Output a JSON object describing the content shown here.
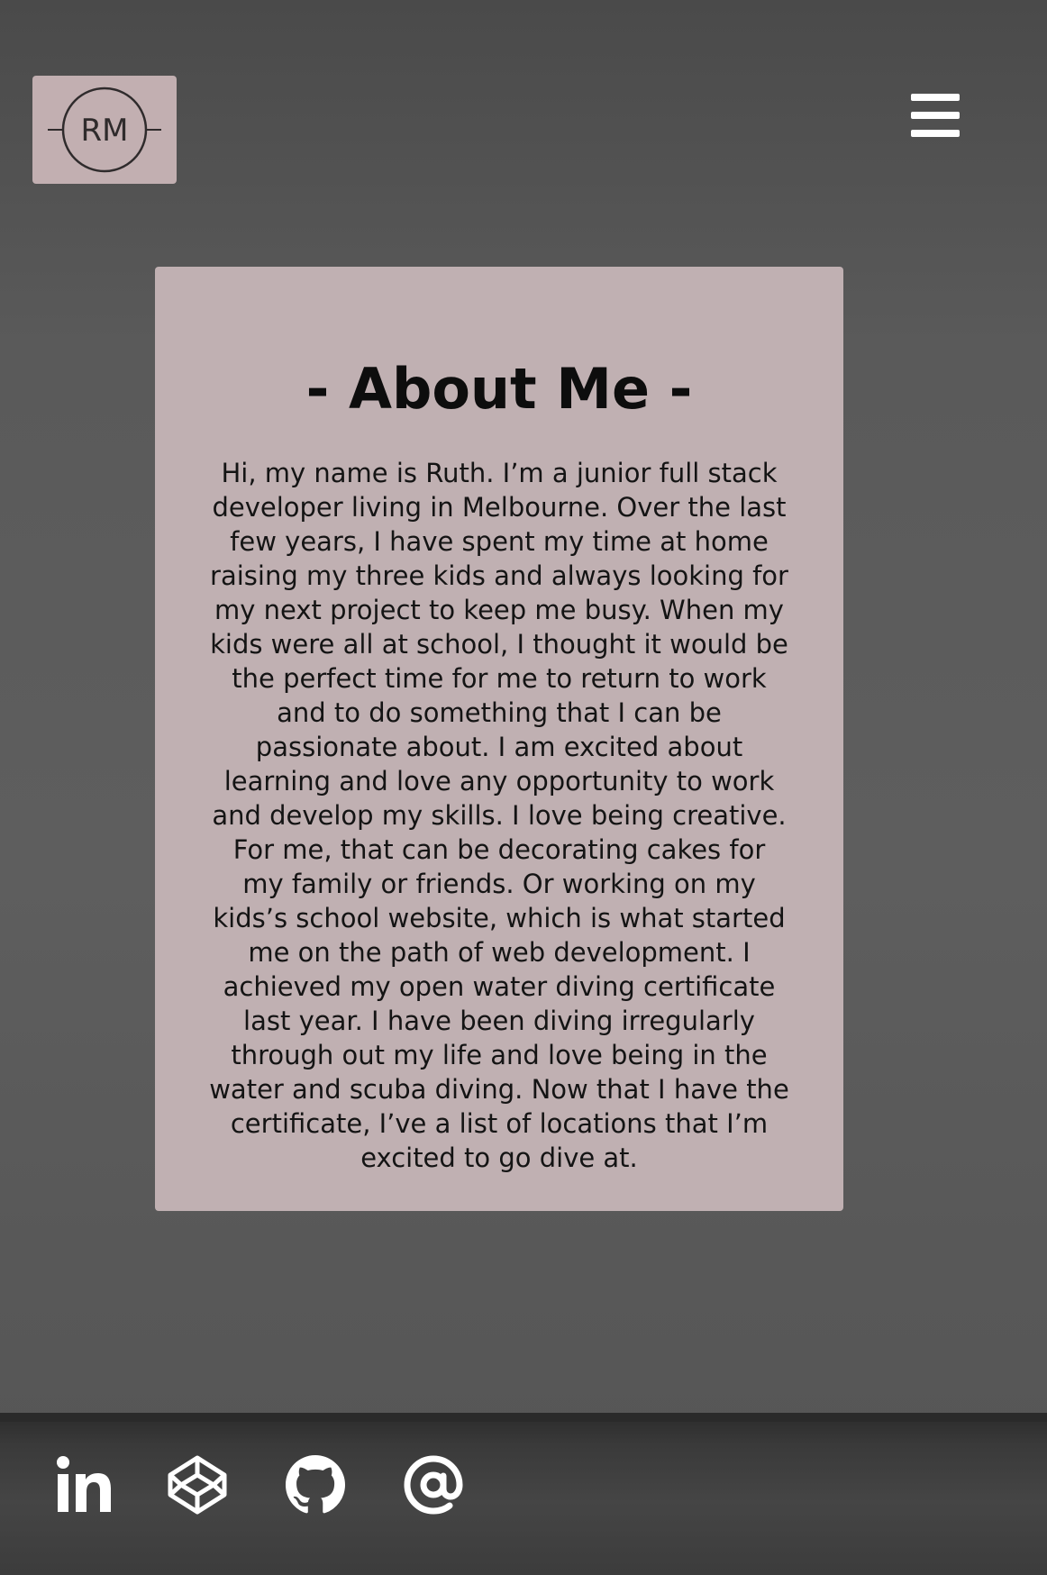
{
  "header": {
    "logo_text": "RM",
    "menu_icon": "hamburger-menu-icon"
  },
  "about": {
    "heading": "- About Me -",
    "body": "Hi, my name is Ruth. I’m a junior full stack developer living in Melbourne. Over the last few years, I have spent my time at home raising my three kids and always looking for my next project to keep me busy. When my kids were all at school, I thought it would be the perfect time for me to return to work and to do something that I can be passionate about. I am excited about learning and love any opportunity to work and develop my skills. I love being creative. For me, that can be decorating cakes for my family or friends. Or working on my kids’s school website, which is what started me on the path of web development. I achieved my open water diving certificate last year. I have been diving irregularly through out my life and love being in the water and scuba diving. Now that I have the certificate, I’ve a list of locations that I’m excited to go dive at."
  },
  "footer": {
    "social_icons": [
      "linkedin-icon",
      "codepen-icon",
      "github-icon",
      "email-at-icon"
    ]
  },
  "colors": {
    "card_background": "#c0b0b2",
    "logo_background": "#c2afb1",
    "page_background": "#5a5a5a",
    "icon_color": "#ffffff"
  }
}
